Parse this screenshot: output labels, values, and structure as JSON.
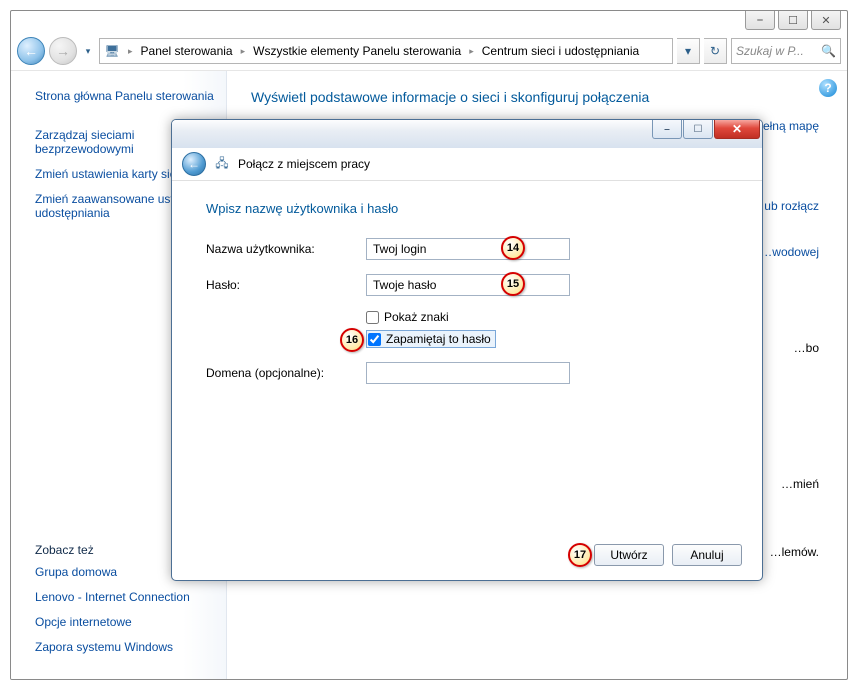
{
  "outer_caption": {
    "min": "⎯",
    "max": "☐",
    "close": "✕"
  },
  "nav": {
    "back_glyph": "←",
    "fwd_glyph": "→",
    "drop_glyph": "▾",
    "refresh_glyph": "↻",
    "search_placeholder": "Szukaj w P...",
    "search_icon": "🔍"
  },
  "breadcrumbs": {
    "icon_glyph": "🖥",
    "sep": "▸",
    "item0": "Panel sterowania",
    "item1": "Wszystkie elementy Panelu sterowania",
    "item2": "Centrum sieci i udostępniania"
  },
  "sidebar": {
    "link0": "Strona główna Panelu sterowania",
    "link1": "Zarządzaj sieciami bezprzewodowymi",
    "link2": "Zmień ustawienia karty sieciowej",
    "link3": "Zmień zaawansowane ustawienia udostępniania",
    "hdr": "Zobacz też",
    "rel0": "Grupa domowa",
    "rel1": "Lenovo - Internet Connection",
    "rel2": "Opcje internetowe",
    "rel3": "Zapora systemu Windows"
  },
  "content": {
    "title": "Wyświetl podstawowe informacje o sieci i skonfiguruj połączenia",
    "r0": "…ełną mapę",
    "r1": "…ub rozłącz",
    "r2": "…wodowej",
    "r3": "…bo",
    "r4": "…mień",
    "r5": "…lemów.",
    "help": "?"
  },
  "dialog": {
    "caption": {
      "min": "⎯",
      "max": "☐",
      "close": "✕"
    },
    "icon": "🖧",
    "title": "Połącz z miejscem pracy",
    "heading": "Wpisz nazwę użytkownika i hasło",
    "label_user": "Nazwa użytkownika:",
    "value_user": "Twoj login",
    "label_pass": "Hasło:",
    "value_pass": "Twoje hasło",
    "chk_show": "Pokaż znaki",
    "chk_remember": "Zapamiętaj to hasło",
    "label_domain": "Domena (opcjonalne):",
    "value_domain": "",
    "btn_create": "Utwórz",
    "btn_cancel": "Anuluj",
    "back_glyph": "←"
  },
  "annotations": {
    "a14": "14",
    "a15": "15",
    "a16": "16",
    "a17": "17"
  }
}
